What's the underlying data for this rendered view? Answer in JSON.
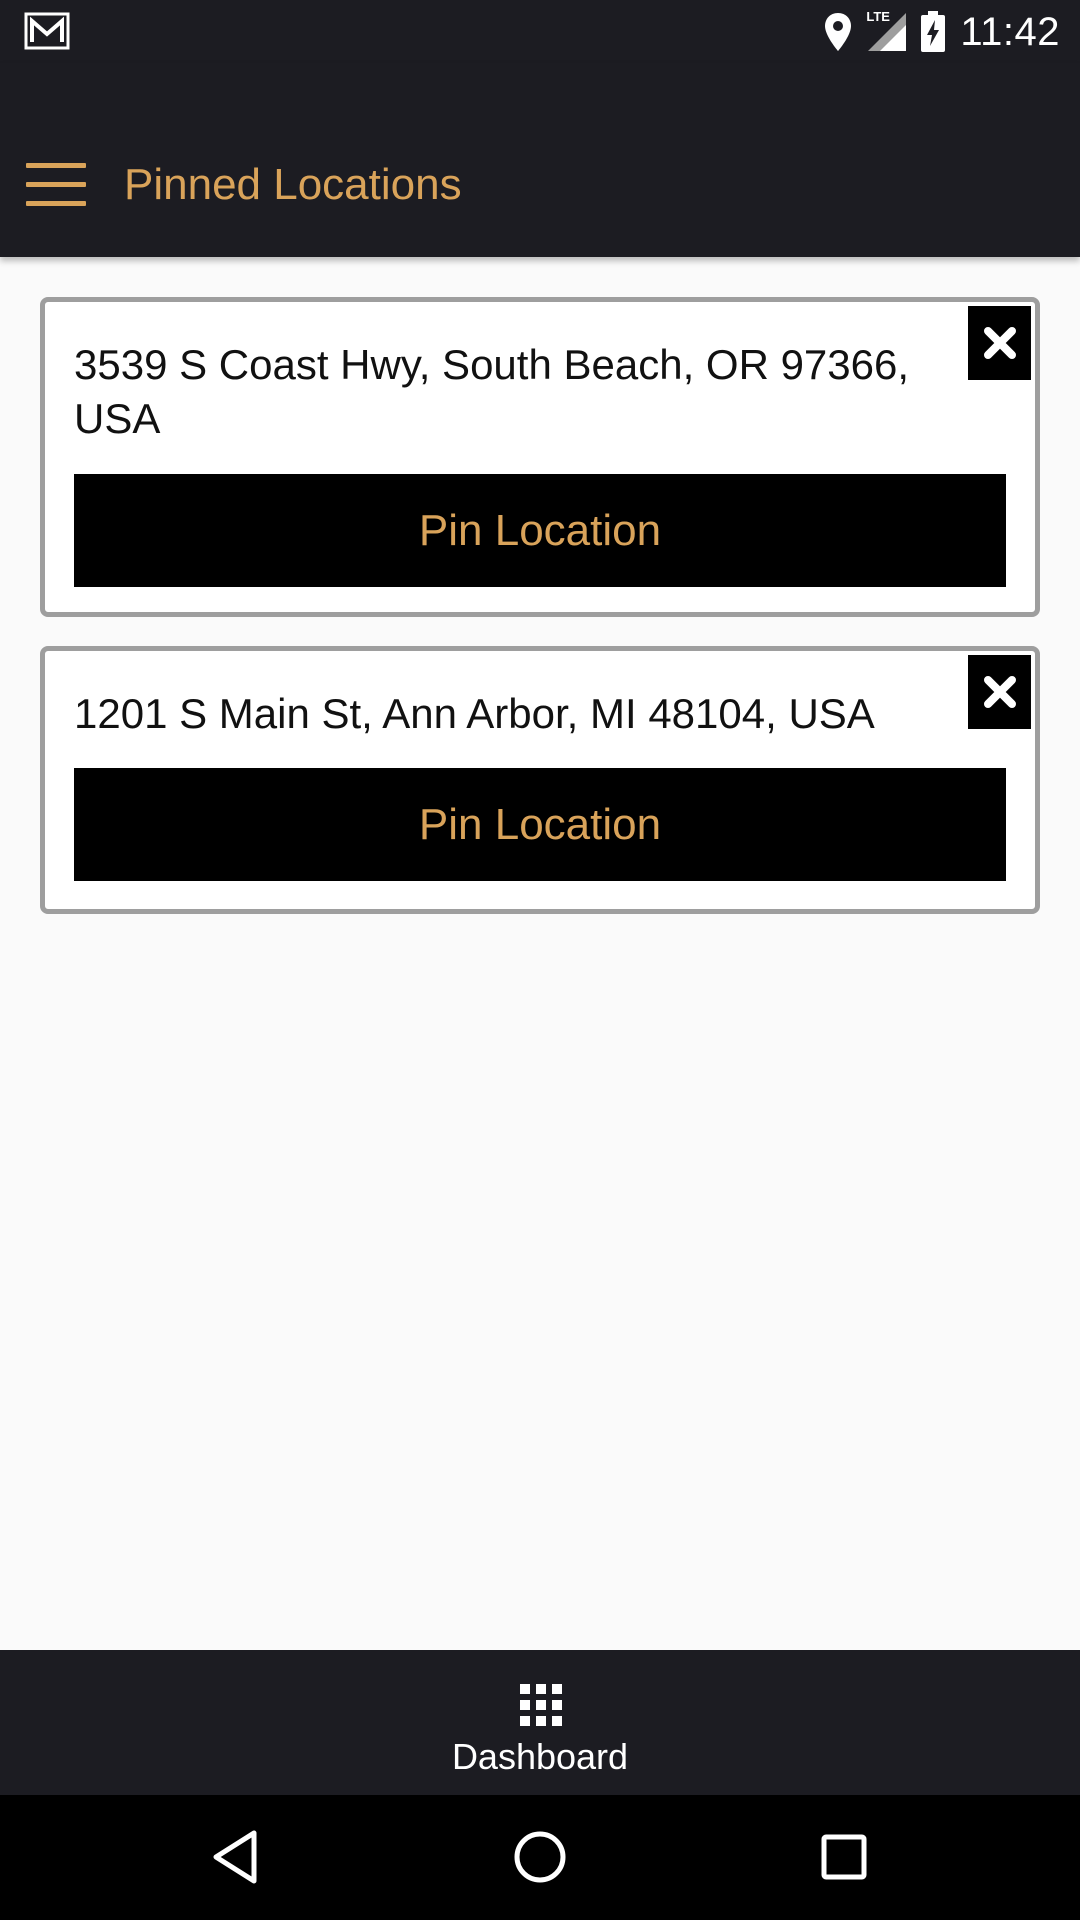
{
  "status_bar": {
    "time": "11:42",
    "icons": [
      "gmail-icon",
      "location-pin-icon",
      "lte-signal-icon",
      "battery-charging-icon"
    ],
    "network_label": "LTE"
  },
  "app_bar": {
    "title": "Pinned Locations",
    "menu_icon": "hamburger-menu-icon"
  },
  "locations": [
    {
      "address": "3539 S Coast Hwy, South Beach, OR 97366, USA",
      "button_label": "Pin Location",
      "remove_icon": "close-icon"
    },
    {
      "address": "1201 S Main St, Ann Arbor, MI 48104, USA",
      "button_label": "Pin Location",
      "remove_icon": "close-icon"
    }
  ],
  "bottom_nav": {
    "dashboard_label": "Dashboard",
    "dashboard_icon": "grid-icon"
  },
  "system_nav": {
    "buttons": [
      "back-icon",
      "home-icon",
      "recents-icon"
    ]
  },
  "colors": {
    "accent": "#d9a35a",
    "bar_background": "#1c1c22",
    "page_background": "#fafafa",
    "card_border": "#9e9e9e"
  }
}
